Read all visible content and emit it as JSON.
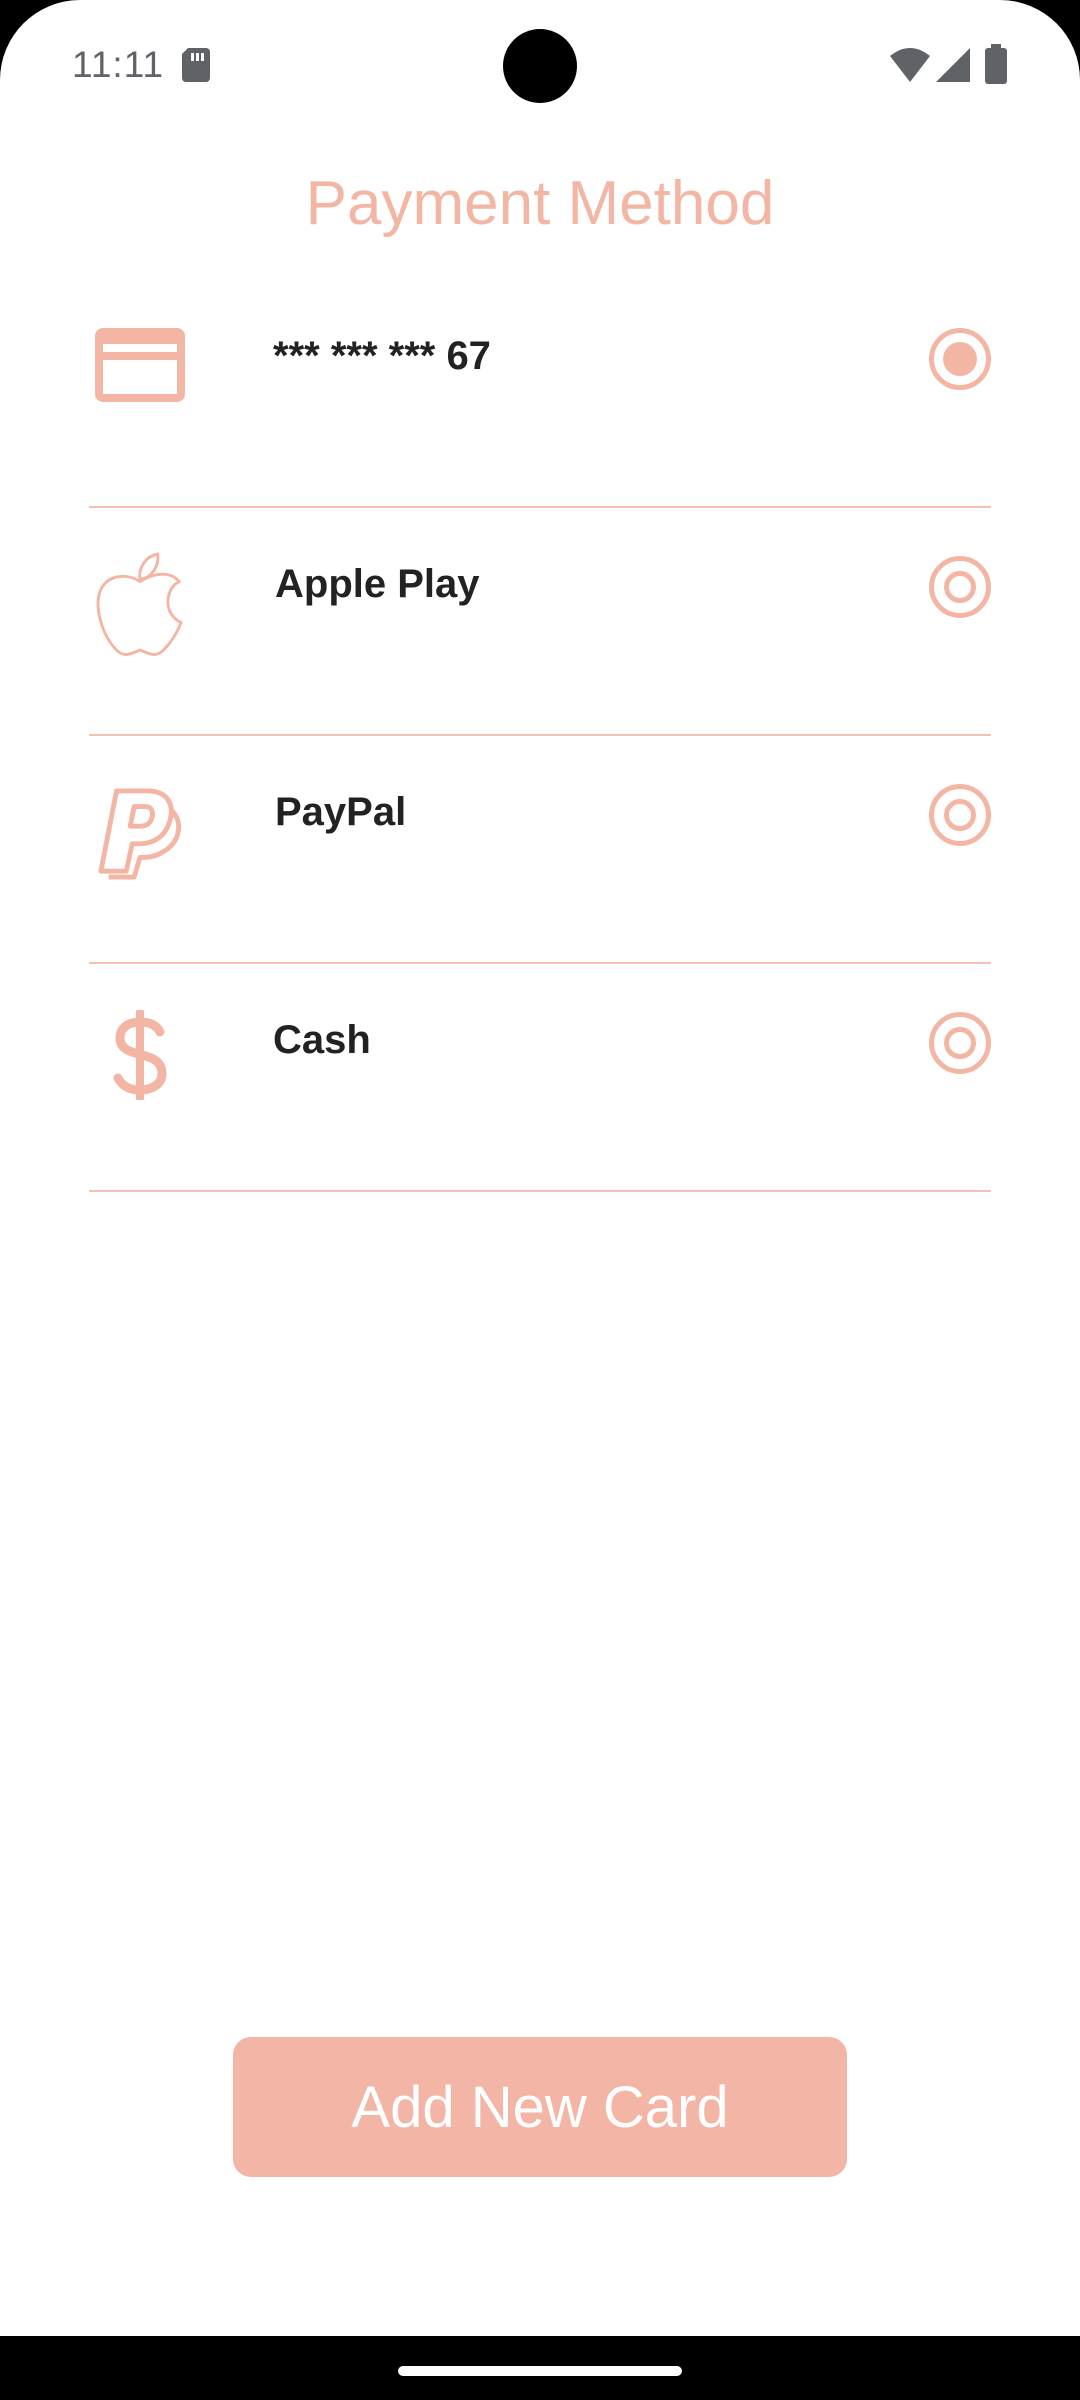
{
  "status_bar": {
    "time": "11:11",
    "icons": [
      "sd-card-icon",
      "wifi-icon",
      "signal-icon",
      "battery-icon"
    ]
  },
  "page": {
    "title": "Payment Method"
  },
  "payment_methods": [
    {
      "label": "*** *** *** 67",
      "icon": "credit-card-icon",
      "selected": true
    },
    {
      "label": "Apple Play",
      "icon": "apple-icon",
      "selected": false
    },
    {
      "label": "PayPal",
      "icon": "paypal-icon",
      "selected": false
    },
    {
      "label": "Cash",
      "icon": "dollar-icon",
      "selected": false
    }
  ],
  "actions": {
    "add_card_label": "Add New Card"
  },
  "colors": {
    "accent": "#f4b6a4",
    "button": "#f3b5a5",
    "text": "#222222",
    "divider": "#f4c1b3"
  }
}
